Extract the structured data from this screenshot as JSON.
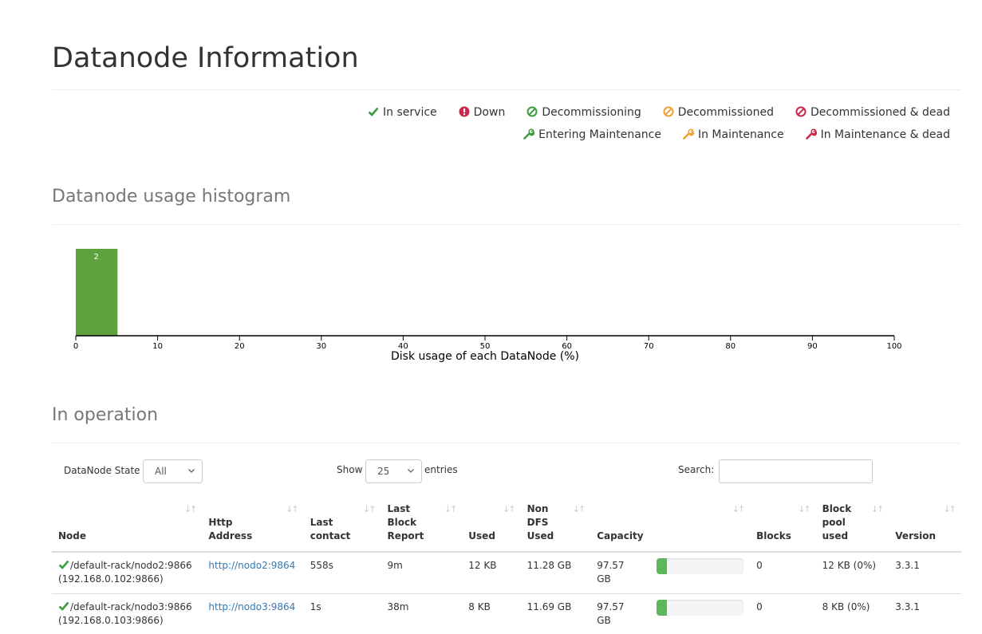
{
  "page": {
    "title": "Datanode Information"
  },
  "legend": {
    "items": [
      {
        "label": "In service",
        "icon": "check-icon",
        "color": "#3c9d3c"
      },
      {
        "label": "Down",
        "icon": "exclamation-circle-icon",
        "color": "#c9284b"
      },
      {
        "label": "Decommissioning",
        "icon": "ban-icon",
        "color": "#3c9d3c"
      },
      {
        "label": "Decommissioned",
        "icon": "ban-icon",
        "color": "#f0a030"
      },
      {
        "label": "Decommissioned & dead",
        "icon": "ban-icon",
        "color": "#c9284b"
      },
      {
        "label": "Entering Maintenance",
        "icon": "wrench-icon",
        "color": "#3c9d3c"
      },
      {
        "label": "In Maintenance",
        "icon": "wrench-icon",
        "color": "#f0a030"
      },
      {
        "label": "In Maintenance & dead",
        "icon": "wrench-icon",
        "color": "#c9284b"
      }
    ]
  },
  "histogram": {
    "heading": "Datanode usage histogram"
  },
  "chart_data": {
    "type": "bar",
    "title": "",
    "xlabel": "Disk usage of each DataNode (%)",
    "ylabel": "",
    "xlim": [
      0,
      100
    ],
    "xticks": [
      "0",
      "10",
      "20",
      "30",
      "40",
      "50",
      "60",
      "70",
      "80",
      "90",
      "100"
    ],
    "bins": [
      {
        "x0": 0,
        "x1": 5,
        "count": 2,
        "label": "2"
      }
    ],
    "bar_color": "#5da23d",
    "grid": false
  },
  "operation": {
    "heading": "In operation",
    "state_filter_label": "DataNode State",
    "state_filter_value": "All",
    "show_label": "Show",
    "entries_value": "25",
    "entries_label": "entries",
    "search_label": "Search:",
    "search_value": ""
  },
  "table": {
    "columns": [
      {
        "lines": [
          "Node"
        ]
      },
      {
        "lines": [
          "Http",
          "Address"
        ]
      },
      {
        "lines": [
          "Last",
          "contact"
        ]
      },
      {
        "lines": [
          "Last",
          "Block",
          "Report"
        ]
      },
      {
        "lines": [
          "Used"
        ]
      },
      {
        "lines": [
          "Non",
          "DFS",
          "Used"
        ]
      },
      {
        "lines": [
          "Capacity"
        ]
      },
      {
        "lines": [
          "Blocks"
        ]
      },
      {
        "lines": [
          "Block",
          "pool",
          "used"
        ]
      },
      {
        "lines": [
          "Version"
        ]
      }
    ],
    "rows": [
      {
        "node": "/default-rack/nodo2:9866",
        "node_ip": "(192.168.0.102:9866)",
        "http": "http://nodo2:9864",
        "last_contact": "558s",
        "last_block_report": "9m",
        "used": "12 KB",
        "non_dfs_used": "11.28 GB",
        "capacity": "97.57 GB",
        "usage_pct": 12,
        "blocks": "0",
        "block_pool_used": "12 KB (0%)",
        "version": "3.3.1"
      },
      {
        "node": "/default-rack/nodo3:9866",
        "node_ip": "(192.168.0.103:9866)",
        "http": "http://nodo3:9864",
        "last_contact": "1s",
        "last_block_report": "38m",
        "used": "8 KB",
        "non_dfs_used": "11.69 GB",
        "capacity": "97.57 GB",
        "usage_pct": 12,
        "blocks": "0",
        "block_pool_used": "8 KB (0%)",
        "version": "3.3.1"
      }
    ]
  }
}
